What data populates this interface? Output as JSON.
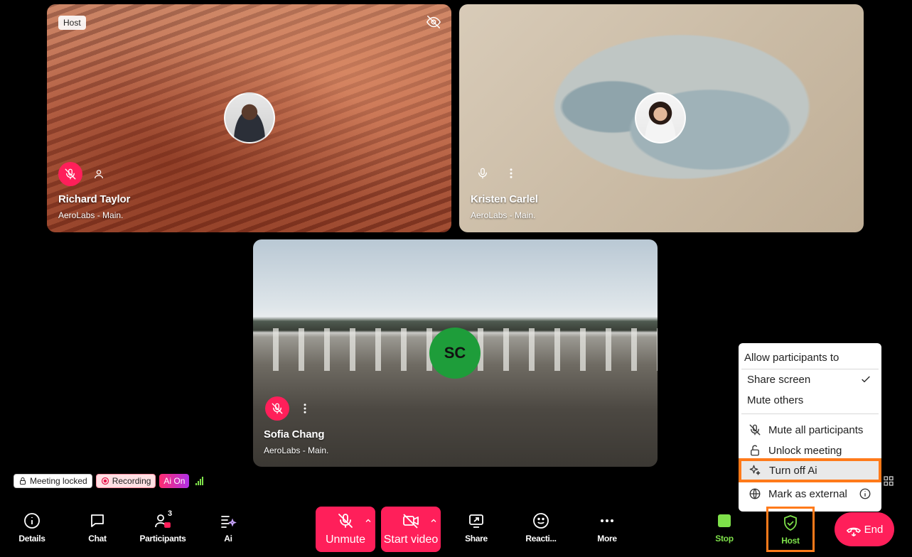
{
  "tiles": [
    {
      "name": "Richard Taylor",
      "org": "AeroLabs - Main.",
      "badge": "Host"
    },
    {
      "name": "Kristen Carlel",
      "org": "AeroLabs - Main."
    },
    {
      "name": "Sofia Chang",
      "org": "AeroLabs - Main.",
      "initials": "SC"
    }
  ],
  "status": {
    "locked": "Meeting locked",
    "recording": "Recording",
    "ai": "Ai On"
  },
  "toolbar": {
    "details": "Details",
    "chat": "Chat",
    "participants": "Participants",
    "participants_count": "3",
    "ai": "Ai",
    "unmute": "Unmute",
    "start_video": "Start video",
    "share": "Share",
    "reactions": "Reacti...",
    "more": "More",
    "stop": "Stop",
    "host": "Host",
    "end": "End"
  },
  "host_menu": {
    "heading": "Allow participants to",
    "share_screen": "Share screen",
    "mute_others": "Mute others",
    "mute_all": "Mute all participants",
    "unlock": "Unlock meeting",
    "turn_off_ai": "Turn off Ai",
    "mark_external": "Mark as external"
  },
  "colors": {
    "accent_red": "#ff1f5a",
    "highlight_orange": "#ff7a1a",
    "stop_green": "#7ee04a",
    "initials_bg": "#1e9d3a"
  }
}
